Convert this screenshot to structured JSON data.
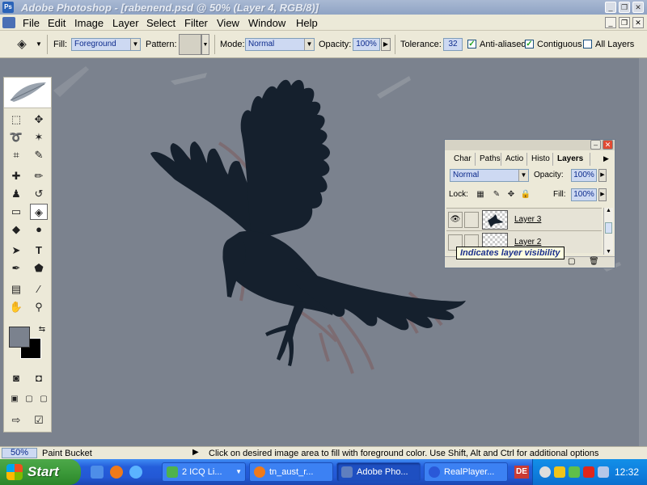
{
  "window": {
    "title": "Adobe Photoshop - [rabenend.psd @ 50% (Layer 4, RGB/8)]"
  },
  "menu": [
    "File",
    "Edit",
    "Image",
    "Layer",
    "Select",
    "Filter",
    "View",
    "Window",
    "Help"
  ],
  "options": {
    "fill_label": "Fill:",
    "fill_value": "Foreground",
    "pattern_label": "Pattern:",
    "mode_label": "Mode:",
    "mode_value": "Normal",
    "opacity_label": "Opacity:",
    "opacity_value": "100%",
    "tolerance_label": "Tolerance:",
    "tolerance_value": "32",
    "anti_aliased": "Anti-aliased",
    "contiguous": "Contiguous",
    "all_layers": "All Layers"
  },
  "layers_panel": {
    "tabs": [
      "Char",
      "Paths",
      "Actio",
      "Histo",
      "Layers"
    ],
    "blend_mode": "Normal",
    "opacity_label": "Opacity:",
    "opacity_value": "100%",
    "lock_label": "Lock:",
    "fill_label": "Fill:",
    "fill_value": "100%",
    "layers": [
      {
        "name": "Layer 3",
        "visible": true
      },
      {
        "name": "Layer 2",
        "visible": false
      }
    ],
    "tooltip": "Indicates layer visibility"
  },
  "status": {
    "zoom": "50%",
    "tool": "Paint Bucket",
    "hint": "Click on desired image area to fill with foreground color.  Use Shift, Alt and Ctrl for additional options"
  },
  "taskbar": {
    "start": "Start",
    "buttons": [
      "2 ICQ Li...",
      "tn_aust_r...",
      "Adobe Pho...",
      "RealPlayer..."
    ],
    "lang": "DE",
    "clock": "12:32"
  },
  "colors": {
    "canvas_bg": "#7b828e",
    "crow": "#15202d",
    "sketch": "#7d6a70",
    "xp_blue": "#245edb"
  }
}
